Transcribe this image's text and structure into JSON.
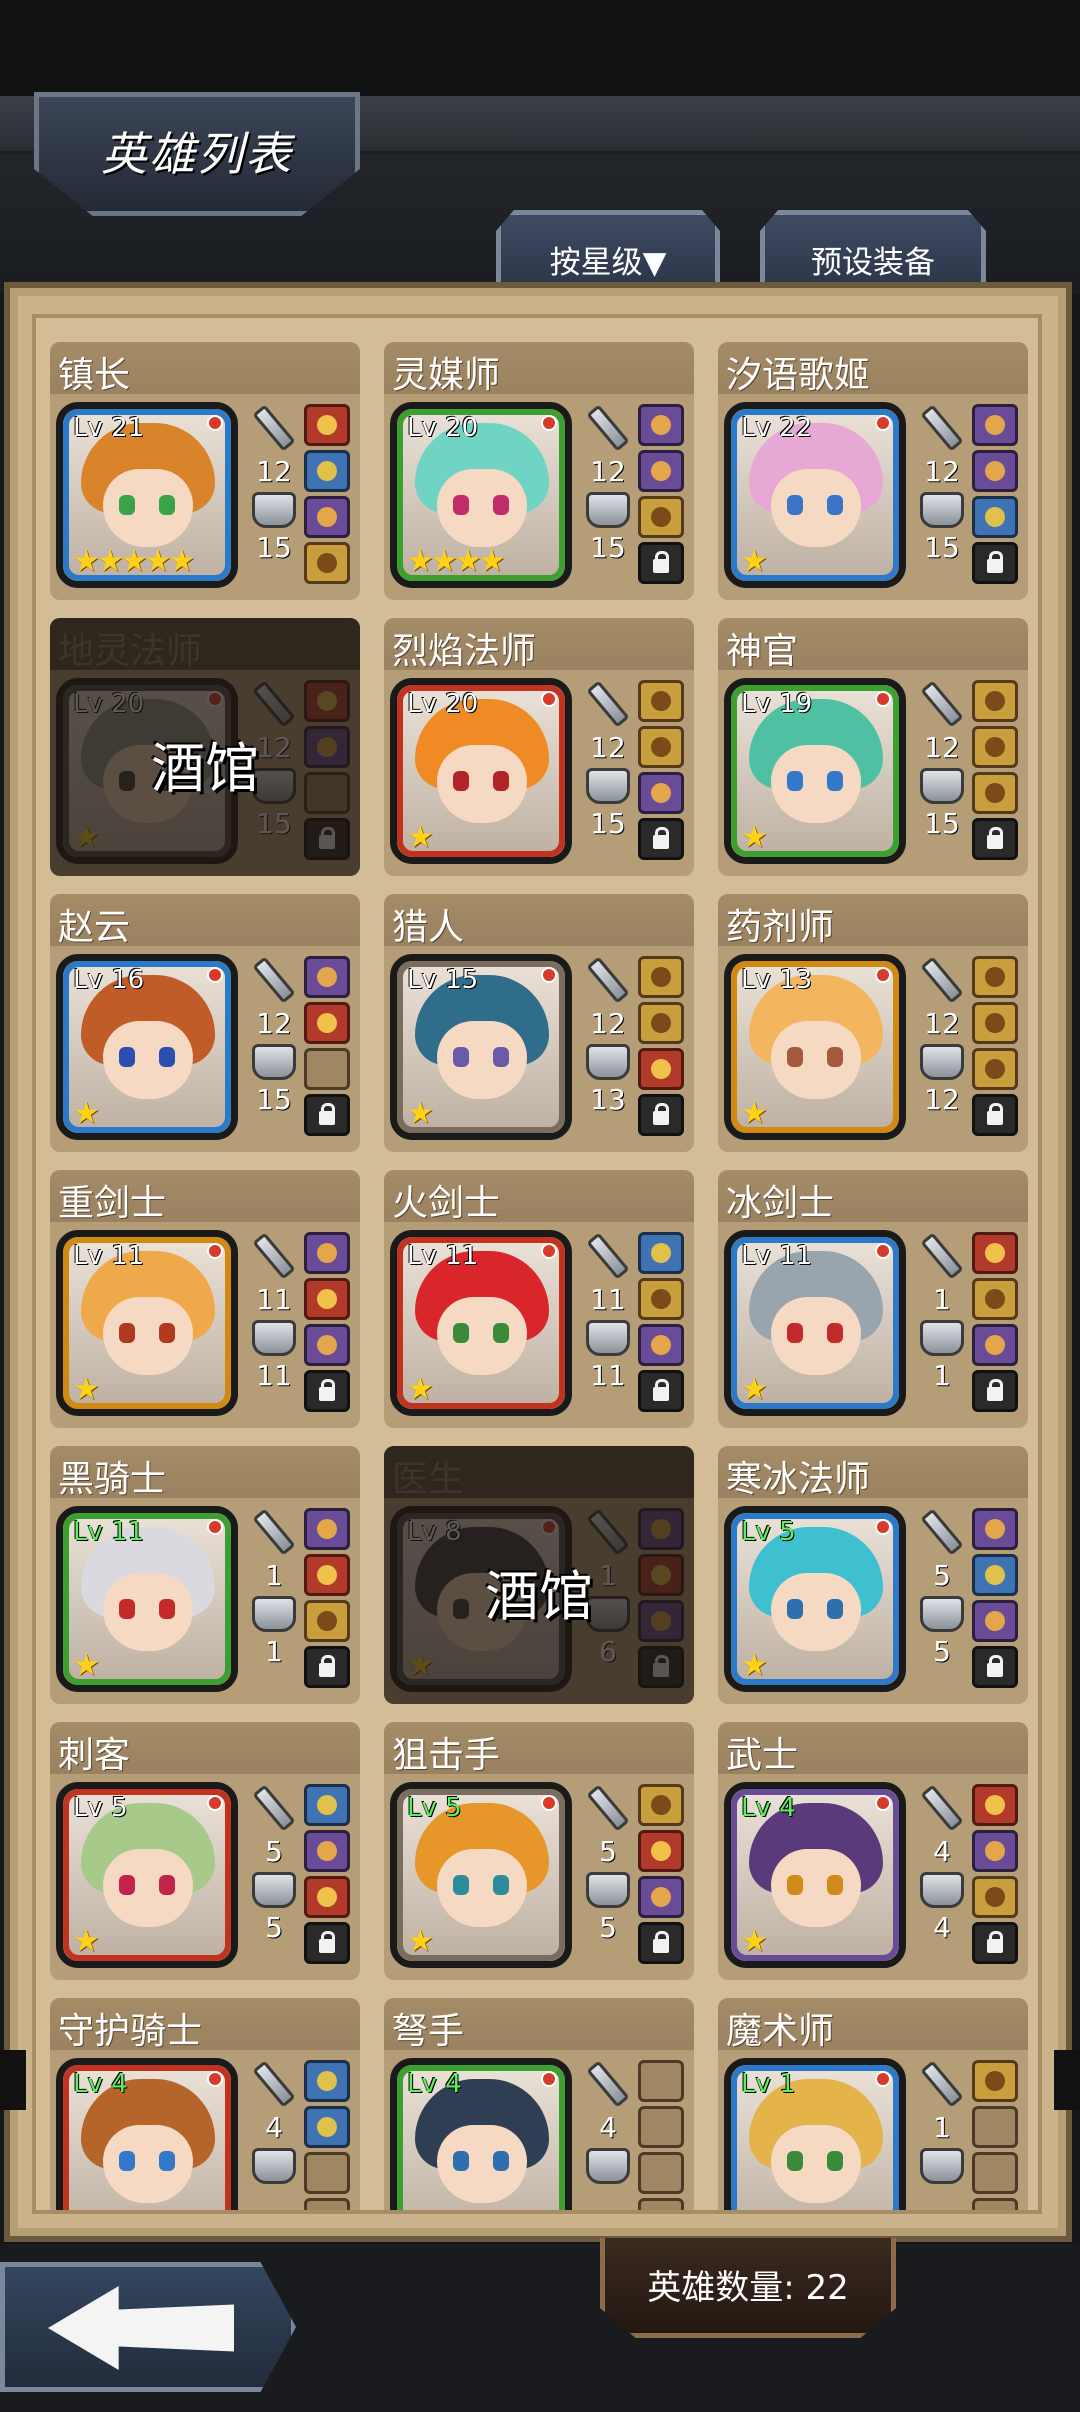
{
  "title": "英雄列表",
  "tabs": {
    "sort": "按星级▼",
    "preset": "预设装备"
  },
  "footer": {
    "hero_count": "英雄数量: 22"
  },
  "heroes": [
    {
      "name": "镇长",
      "level": "Lv 21",
      "stars": "★★★★★",
      "atk": "12",
      "def": "15",
      "frame": "#2b79c9",
      "hair": "#d9832a",
      "eye": "#3aa34a",
      "slots": [
        "red",
        "blue",
        "purple",
        "gold"
      ],
      "locked": false,
      "lv_green": false
    },
    {
      "name": "灵媒师",
      "level": "Lv 20",
      "stars": "★★★★",
      "atk": "12",
      "def": "15",
      "frame": "#3ca030",
      "hair": "#6fd4c4",
      "eye": "#c22c6b",
      "slots": [
        "purple",
        "purple",
        "gold",
        "lock"
      ],
      "locked": false,
      "lv_green": false
    },
    {
      "name": "汐语歌姬",
      "level": "Lv 22",
      "stars": "★",
      "atk": "12",
      "def": "15",
      "frame": "#2b79c9",
      "hair": "#e7a8d6",
      "eye": "#3b74c7",
      "slots": [
        "purple",
        "purple",
        "blue",
        "lock"
      ],
      "locked": false,
      "lv_green": false
    },
    {
      "name": "地灵法师",
      "level": "Lv 20",
      "stars": "★",
      "atk": "12",
      "def": "15",
      "frame": "#4e4e4e",
      "hair": "#8f958b",
      "eye": "#3a3a3a",
      "slots": [
        "red",
        "purple",
        "empty",
        "lock"
      ],
      "locked": true,
      "lv_green": false,
      "tavern": "酒馆"
    },
    {
      "name": "烈焰法师",
      "level": "Lv 20",
      "stars": "★",
      "atk": "12",
      "def": "15",
      "frame": "#c2331f",
      "hair": "#f08a24",
      "eye": "#b2232a",
      "slots": [
        "gold",
        "gold",
        "purple",
        "lock"
      ],
      "locked": false,
      "lv_green": false
    },
    {
      "name": "神官",
      "level": "Lv 19",
      "stars": "★",
      "atk": "12",
      "def": "15",
      "frame": "#3ca030",
      "hair": "#4fc1a2",
      "eye": "#3279c9",
      "slots": [
        "gold",
        "gold",
        "gold",
        "lock"
      ],
      "locked": false,
      "lv_green": false
    },
    {
      "name": "赵云",
      "level": "Lv 16",
      "stars": "★",
      "atk": "12",
      "def": "15",
      "frame": "#2b79c9",
      "hair": "#c05c28",
      "eye": "#2b4fb0",
      "slots": [
        "purple",
        "red",
        "empty",
        "lock"
      ],
      "locked": false,
      "lv_green": false
    },
    {
      "name": "猎人",
      "level": "Lv 15",
      "stars": "★",
      "atk": "12",
      "def": "13",
      "frame": "#7a6d60",
      "hair": "#2f6d8a",
      "eye": "#6a5aa9",
      "slots": [
        "gold",
        "gold",
        "red",
        "lock"
      ],
      "locked": false,
      "lv_green": false
    },
    {
      "name": "药剂师",
      "level": "Lv 13",
      "stars": "★",
      "atk": "12",
      "def": "12",
      "frame": "#d08a12",
      "hair": "#f3b65e",
      "eye": "#a35a3c",
      "slots": [
        "gold",
        "gold",
        "gold",
        "lock"
      ],
      "locked": false,
      "lv_green": false
    },
    {
      "name": "重剑士",
      "level": "Lv 11",
      "stars": "★",
      "atk": "11",
      "def": "11",
      "frame": "#d08a12",
      "hair": "#efa84a",
      "eye": "#b03a1e",
      "slots": [
        "purple",
        "red",
        "purple",
        "lock"
      ],
      "locked": false,
      "lv_green": false
    },
    {
      "name": "火剑士",
      "level": "Lv 11",
      "stars": "★",
      "atk": "11",
      "def": "11",
      "frame": "#c2331f",
      "hair": "#d8262a",
      "eye": "#3a8a3a",
      "slots": [
        "blue",
        "gold",
        "purple",
        "lock"
      ],
      "locked": false,
      "lv_green": false
    },
    {
      "name": "冰剑士",
      "level": "Lv 11",
      "stars": "★",
      "atk": "1",
      "def": "1",
      "frame": "#2b79c9",
      "hair": "#9aa4ad",
      "eye": "#c22a2a",
      "slots": [
        "red",
        "gold",
        "purple",
        "lock"
      ],
      "locked": false,
      "lv_green": false
    },
    {
      "name": "黑骑士",
      "level": "Lv 11",
      "stars": "★",
      "atk": "1",
      "def": "1",
      "frame": "#3ca030",
      "hair": "#d9d9df",
      "eye": "#c22a2a",
      "slots": [
        "purple",
        "red",
        "gold",
        "lock"
      ],
      "locked": false,
      "lv_green": true
    },
    {
      "name": "医生",
      "level": "Lv 8",
      "stars": "★",
      "atk": "1",
      "def": "6",
      "frame": "#4e4e4e",
      "hair": "#3a3a40",
      "eye": "#3a3a3a",
      "slots": [
        "purple",
        "red",
        "purple",
        "lock"
      ],
      "locked": true,
      "lv_green": false,
      "tavern": "酒馆"
    },
    {
      "name": "寒冰法师",
      "level": "Lv 5",
      "stars": "★",
      "atk": "5",
      "def": "5",
      "frame": "#2b79c9",
      "hair": "#3fc0d0",
      "eye": "#2e6fb0",
      "slots": [
        "purple",
        "blue",
        "purple",
        "lock"
      ],
      "locked": false,
      "lv_green": true
    },
    {
      "name": "刺客",
      "level": "Lv 5",
      "stars": "★",
      "atk": "5",
      "def": "5",
      "frame": "#c2331f",
      "hair": "#a7c98a",
      "eye": "#c2234b",
      "slots": [
        "blue",
        "purple",
        "red",
        "lock"
      ],
      "locked": false,
      "lv_green": false
    },
    {
      "name": "狙击手",
      "level": "Lv 5",
      "stars": "★",
      "atk": "5",
      "def": "5",
      "frame": "#7a6d60",
      "hair": "#e7962a",
      "eye": "#2b8c9a",
      "slots": [
        "gold",
        "red",
        "purple",
        "lock"
      ],
      "locked": false,
      "lv_green": true
    },
    {
      "name": "武士",
      "level": "Lv 4",
      "stars": "★",
      "atk": "4",
      "def": "4",
      "frame": "#6a4b98",
      "hair": "#5a3a7a",
      "eye": "#d28a1a",
      "slots": [
        "red",
        "purple",
        "gold",
        "lock"
      ],
      "locked": false,
      "lv_green": true
    },
    {
      "name": "守护骑士",
      "level": "Lv 4",
      "stars": "",
      "atk": "4",
      "def": "",
      "frame": "#c2331f",
      "hair": "#b5652a",
      "eye": "#3279c9",
      "slots": [
        "blue",
        "blue",
        "empty",
        "empty"
      ],
      "locked": false,
      "lv_green": true
    },
    {
      "name": "弩手",
      "level": "Lv 4",
      "stars": "",
      "atk": "4",
      "def": "",
      "frame": "#3ca030",
      "hair": "#2f3e52",
      "eye": "#2e6fb0",
      "slots": [
        "empty",
        "empty",
        "empty",
        "empty"
      ],
      "locked": false,
      "lv_green": true
    },
    {
      "name": "魔术师",
      "level": "Lv 1",
      "stars": "",
      "atk": "1",
      "def": "",
      "frame": "#2b79c9",
      "hair": "#e4b34a",
      "eye": "#3a8a3a",
      "slots": [
        "gold",
        "empty",
        "empty",
        "empty"
      ],
      "locked": false,
      "lv_green": true
    }
  ]
}
